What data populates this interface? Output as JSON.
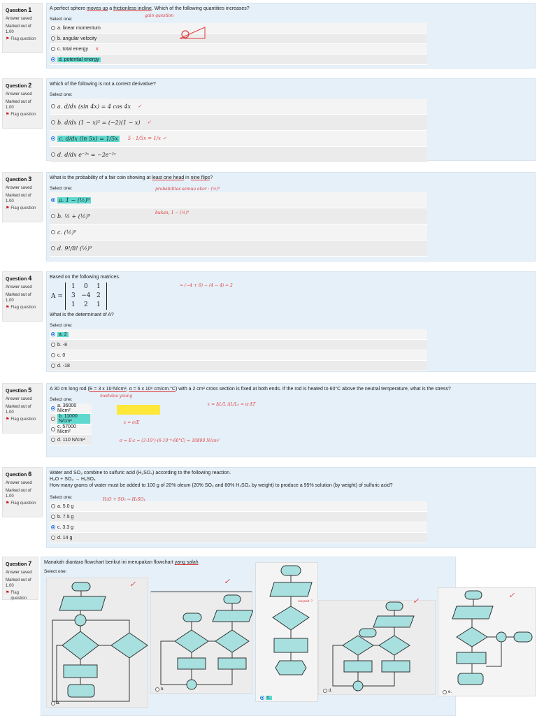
{
  "common": {
    "answer_saved": "Answer saved",
    "marked_out": "Marked out of",
    "marks": "1.00",
    "flag": "Flag question",
    "select_one": "Select one:",
    "question_word": "Question"
  },
  "q1": {
    "no": "1",
    "text_a": "A perfect sphere ",
    "text_b": "moves up",
    "text_c": " a ",
    "text_d": "frictionless incline",
    "text_e": ". Which of the following quantities increases?",
    "note": "gain question",
    "options": [
      "a. linear momentum",
      "b. angular velocity",
      "c. total energy",
      "d. potential energy"
    ],
    "mark_c": "×"
  },
  "q2": {
    "no": "2",
    "text": "Which of the following is not a correct derivative?",
    "options": [
      "a. d/dx (sin 4x) = 4 cos 4x",
      "b. d/dx (1 − x)² = (−2)(1 − x)",
      "c. d/dx (ln 5x) = 1/5x",
      "d. d/dx e⁻²ˣ = −2e⁻²ˣ"
    ],
    "check": "✓",
    "note_c": "5 · 1/5x = 1/x ✓"
  },
  "q3": {
    "no": "3",
    "text_a": "What is the probability of a fair coin showing at ",
    "text_b": "least one head",
    "text_c": " in ",
    "text_d": "nine flips",
    "text_e": "?",
    "options": [
      "a. 1 − (½)⁹",
      "b. ½ + (½)⁹",
      "c. (½)⁹",
      "d. 9!/8! (½)⁹"
    ],
    "note1": "probabilitas semua ekor · (½)⁹",
    "note2": "bukan, 1 − (½)⁹"
  },
  "q4": {
    "no": "4",
    "text": "Based on the following matrices.",
    "matrix_label": "A =",
    "matrix": [
      "1",
      "0",
      "1",
      "3",
      "−4",
      "2",
      "1",
      "2",
      "1"
    ],
    "question": "What is the determinant of A?",
    "options": [
      "a. 2",
      "b. -8",
      "c. 0",
      "d. -18"
    ],
    "note": "= (−4 + 6) − (4 − 4) = 2"
  },
  "q5": {
    "no": "5",
    "text_a": "A 30 cm long rod (",
    "text_b": "E = 3 x 10⁷N/cm²",
    "text_c": ", ",
    "text_d": "α = 6 x 10⁶ cm/cm.°C",
    "text_e": ") with a 2 cm² cross section is fixed at both ends. If the rod is heated to 60°C above the neutral temperature, what is the stress?",
    "note_under": "modulus young",
    "options": [
      "a. 36000 N/cm²",
      "b. 11000 N/cm²",
      "c. 57000 N/cm²",
      "d. 110 N/cm²"
    ],
    "note1": "ε = ΔL/L     ΔL/L₀ = α·ΔT",
    "note2": "ε = σ/E",
    "note3": "σ = E·ε = (3·10⁷)·(6·10⁻⁶·60°C) = 10800 N/cm²"
  },
  "q6": {
    "no": "6",
    "text": "Water and SO₃ combine to sulfuric acid (H₂SO₄) according to the following reaction.",
    "reaction": "H₂O + SO₃ → H₂SO₄",
    "question": "How many grams of water must be added to 100 g of 20% oleum (20% SO₃ and 80% H₂SO₄ by weight) to produce a 95% solution (by weight) of sulfuric acid?",
    "options": [
      "a. 5.0 g",
      "b. 7.5 g",
      "c. 3.3 g",
      "d. 14 g"
    ],
    "note": "H₂O + SO₃ → H₂SO₄"
  },
  "q7": {
    "no": "7",
    "text_a": "Manakah diantara flowchart berikut ini merupakan flowchart ",
    "text_b": "yang salah",
    "labels": [
      "a.",
      "b.",
      "c.",
      "d.",
      "e."
    ],
    "note": "output ?",
    "check": "✓"
  }
}
